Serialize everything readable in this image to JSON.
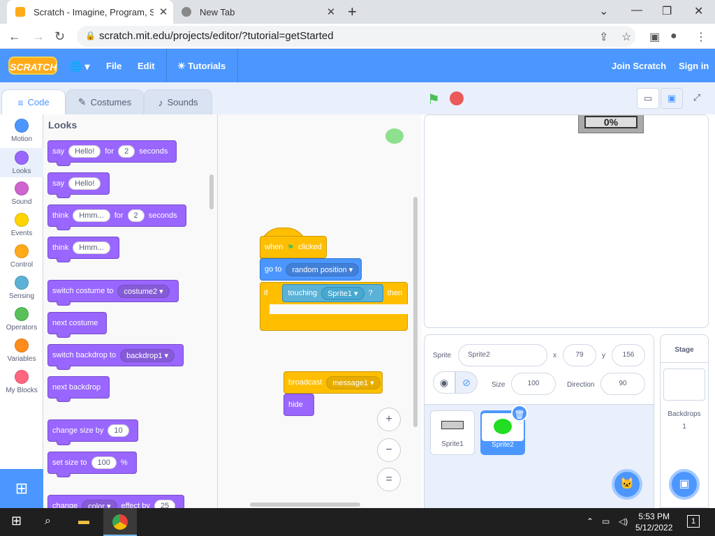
{
  "browser": {
    "tabs": [
      {
        "title": "Scratch - Imagine, Program, Sha",
        "close": "✕"
      },
      {
        "title": "New Tab",
        "close": "✕"
      }
    ],
    "new_tab": "+",
    "window_controls": {
      "min": "⌄",
      "max": "—",
      "restore": "❐",
      "close": "✕"
    },
    "url": "scratch.mit.edu/projects/editor/?tutorial=getStarted"
  },
  "menubar": {
    "logo": "SCRATCH",
    "globe": "🌐 ▾",
    "file": "File",
    "edit": "Edit",
    "tutorials": "Tutorials",
    "join": "Join Scratch",
    "signin": "Sign in",
    "brand_color": "#4c97ff"
  },
  "editor_tabs": {
    "code": "Code",
    "costumes": "Costumes",
    "sounds": "Sounds"
  },
  "categories": [
    {
      "label": "Motion",
      "color": "#4c97ff"
    },
    {
      "label": "Looks",
      "color": "#9966ff"
    },
    {
      "label": "Sound",
      "color": "#cf63cf"
    },
    {
      "label": "Events",
      "color": "#ffd500"
    },
    {
      "label": "Control",
      "color": "#ffab19"
    },
    {
      "label": "Sensing",
      "color": "#5cb1d6"
    },
    {
      "label": "Operators",
      "color": "#59c059"
    },
    {
      "label": "Variables",
      "color": "#ff8c1a"
    },
    {
      "label": "My Blocks",
      "color": "#ff6680"
    }
  ],
  "palette": {
    "title": "Looks",
    "say_for": {
      "say": "say",
      "msg": "Hello!",
      "for": "for",
      "secs": "2",
      "seconds": "seconds"
    },
    "say": {
      "say": "say",
      "msg": "Hello!"
    },
    "think_for": {
      "think": "think",
      "msg": "Hmm...",
      "for": "for",
      "secs": "2",
      "seconds": "seconds"
    },
    "think": {
      "think": "think",
      "msg": "Hmm..."
    },
    "switch_costume": {
      "label": "switch costume to",
      "value": "costume2 ▾"
    },
    "next_costume": "next costume",
    "switch_backdrop": {
      "label": "switch backdrop to",
      "value": "backdrop1 ▾"
    },
    "next_backdrop": "next backdrop",
    "change_size": {
      "label": "change size by",
      "value": "10"
    },
    "set_size": {
      "label": "set size to",
      "value": "100",
      "unit": "%"
    },
    "change_effect": {
      "label": "change",
      "effect": "color ▾",
      "by": "effect by",
      "value": "25"
    }
  },
  "scripts": {
    "when_flag": {
      "when": "when",
      "clicked": "clicked"
    },
    "goto": {
      "label": "go to",
      "value": "random position ▾"
    },
    "if_block": {
      "if": "if",
      "touching": "touching",
      "target": "Sprite1 ▾",
      "q": "?",
      "then": "then"
    },
    "broadcast": {
      "label": "broadcast",
      "value": "message1 ▾"
    },
    "hide": "hide",
    "zoom_in": "+",
    "zoom_out": "−",
    "zoom_reset": "="
  },
  "stage": {
    "monitor": "0%"
  },
  "sprite_info": {
    "sprite_label": "Sprite",
    "sprite_name": "Sprite2",
    "x_label": "x",
    "x": "79",
    "y_label": "y",
    "y": "156",
    "size_label": "Size",
    "size": "100",
    "direction_label": "Direction",
    "direction": "90"
  },
  "sprites": [
    {
      "name": "Sprite1"
    },
    {
      "name": "Sprite2"
    }
  ],
  "stage_selector": {
    "title": "Stage",
    "backdrops_label": "Backdrops",
    "backdrops_count": "1"
  },
  "taskbar": {
    "time": "5:53 PM",
    "date": "5/12/2022",
    "notif": "1"
  }
}
